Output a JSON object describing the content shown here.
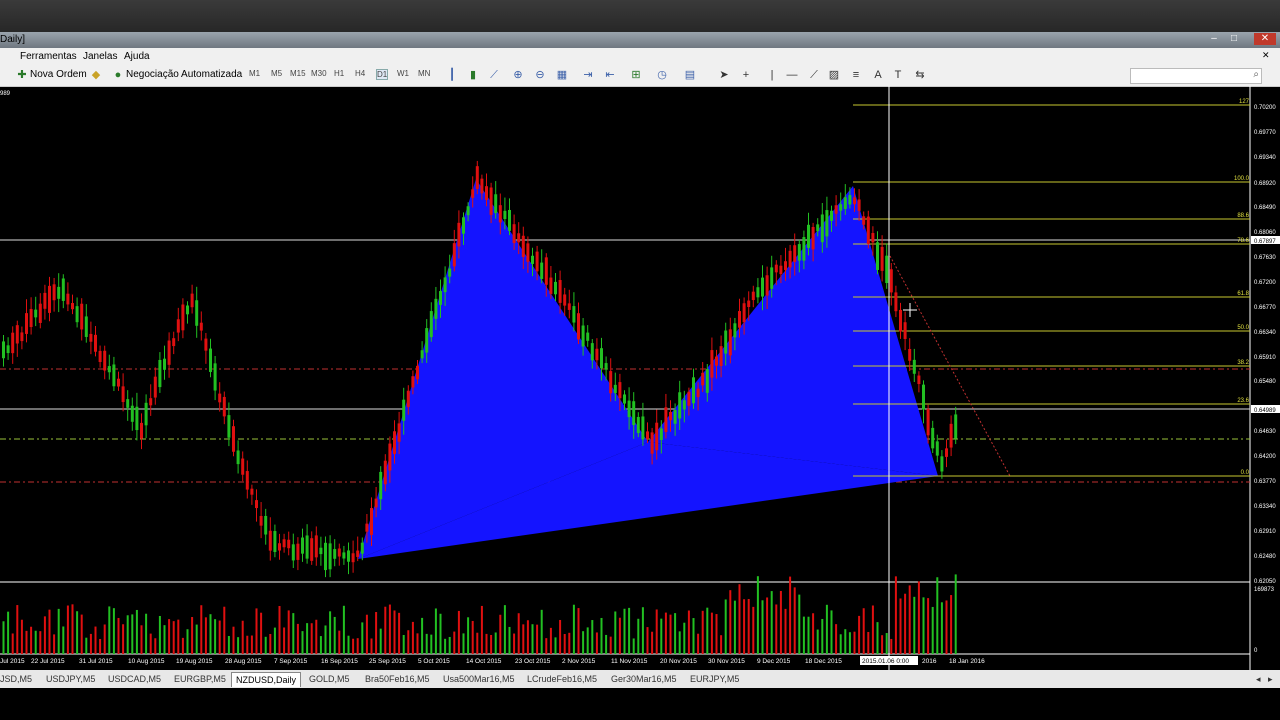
{
  "window": {
    "title": "Daily]"
  },
  "menu": {
    "items": [
      "Ferramentas",
      "Janelas",
      "Ajuda"
    ]
  },
  "toolbar": {
    "new_order": "Nova Ordem",
    "auto_trading": "Negociação Automatizada",
    "timeframes": [
      "M1",
      "M5",
      "M15",
      "M30",
      "H1",
      "H4",
      "D1",
      "W1",
      "MN"
    ]
  },
  "chart": {
    "corner_label": "989",
    "price_labels": [
      "0.70200",
      "0.69770",
      "0.69340",
      "0.68920",
      "0.68490",
      "0.68060",
      "0.67897",
      "0.67630",
      "0.67200",
      "0.66770",
      "0.66340",
      "0.65910",
      "0.65480",
      "0.64989",
      "0.64630",
      "0.64200",
      "0.63770",
      "0.63340",
      "0.62910",
      "0.62480",
      "0.62050"
    ],
    "date_labels": [
      "Jul 2015",
      "22 Jul 2015",
      "31 Jul 2015",
      "10 Aug 2015",
      "19 Aug 2015",
      "28 Aug 2015",
      "7 Sep 2015",
      "16 Sep 2015",
      "25 Sep 2015",
      "5 Oct 2015",
      "14 Oct 2015",
      "23 Oct 2015",
      "2 Nov 2015",
      "11 Nov 2015",
      "20 Nov 2015",
      "30 Nov 2015",
      "9 Dec 2015",
      "18 Dec 2015",
      "2015.01.06 0:00",
      "2016",
      "18 Jan 2016"
    ],
    "fib_labels": [
      "127",
      "100.0",
      "88.6",
      "78.6",
      "61.8",
      "50.0",
      "38.2",
      "23.6",
      "0.0"
    ],
    "volume_max": "169873",
    "volume_zero": "0"
  },
  "tabs": {
    "items": [
      "JSD,M5",
      "USDJPY,M5",
      "USDCAD,M5",
      "EURGBP,M5",
      "NZDUSD,Daily",
      "GOLD,M5",
      "Bra50Feb16,M5",
      "Usa500Mar16,M5",
      "LCrudeFeb16,M5",
      "Ger30Mar16,M5",
      "EURJPY,M5"
    ],
    "active": "NZDUSD,Daily"
  }
}
